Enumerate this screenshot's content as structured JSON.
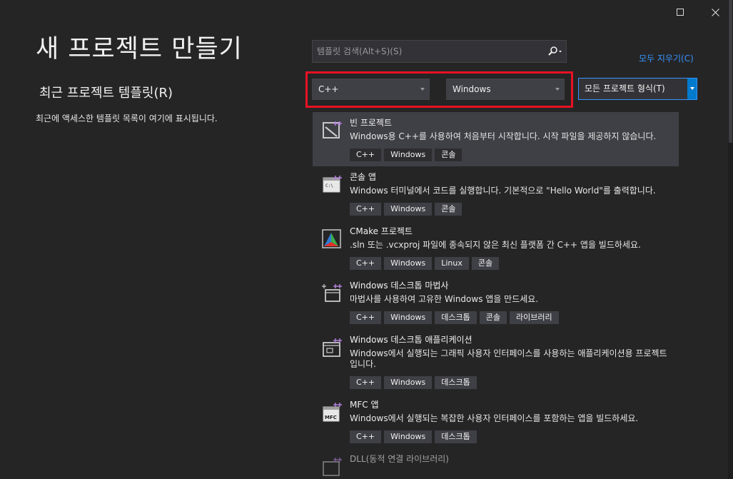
{
  "window": {
    "buttons": [
      "maximize-icon",
      "close-icon"
    ]
  },
  "left": {
    "title": "새 프로젝트 만들기",
    "recent_title": "최근 프로젝트 템플릿(R)",
    "recent_empty": "최근에 액세스한 템플릿 목록이 여기에 표시됩니다."
  },
  "search": {
    "placeholder": "템플릿 검색(Alt+S)(S)",
    "value": "",
    "icon": "search-icon"
  },
  "clear_all": "모두 지우기(C)",
  "filters": {
    "language": "C++",
    "platform": "Windows",
    "project_type": "모든 프로젝트 형식(T)",
    "highlight_color": "#e81123"
  },
  "templates": [
    {
      "name": "빈 프로젝트",
      "desc": "Windows용 C++를 사용하여 처음부터 시작합니다. 시작 파일을 제공하지 않습니다.",
      "tags": [
        "C++",
        "Windows",
        "콘솔"
      ],
      "icon": "empty-project-icon",
      "selected": true
    },
    {
      "name": "콘솔 앱",
      "desc": "Windows 터미널에서 코드를 실행합니다. 기본적으로 \"Hello World\"를 출력합니다.",
      "tags": [
        "C++",
        "Windows",
        "콘솔"
      ],
      "icon": "console-app-icon"
    },
    {
      "name": "CMake 프로젝트",
      "desc": ".sln 또는 .vcxproj 파일에 종속되지 않은 최신 플랫폼 간 C++ 앱을 빌드하세요.",
      "tags": [
        "C++",
        "Windows",
        "Linux",
        "콘솔"
      ],
      "icon": "cmake-icon"
    },
    {
      "name": "Windows 데스크톱 마법사",
      "desc": "마법사를 사용하여 고유한 Windows 앱을 만드세요.",
      "tags": [
        "C++",
        "Windows",
        "데스크톱",
        "콘솔",
        "라이브러리"
      ],
      "icon": "desktop-wizard-icon"
    },
    {
      "name": "Windows 데스크톱 애플리케이션",
      "desc": "Windows에서 실행되는 그래픽 사용자 인터페이스를 사용하는 애플리케이션용 프로젝트입니다.",
      "tags": [
        "C++",
        "Windows",
        "데스크톱"
      ],
      "icon": "desktop-app-icon"
    },
    {
      "name": "MFC 앱",
      "desc": "Windows에서 실행되는 복잡한 사용자 인터페이스를 포함하는 앱을 빌드하세요.",
      "tags": [
        "C++",
        "Windows",
        "데스크톱"
      ],
      "icon": "mfc-icon"
    },
    {
      "name": "DLL(동적 연결 라이브러리)",
      "desc": "",
      "tags": [],
      "icon": "dll-icon"
    }
  ]
}
